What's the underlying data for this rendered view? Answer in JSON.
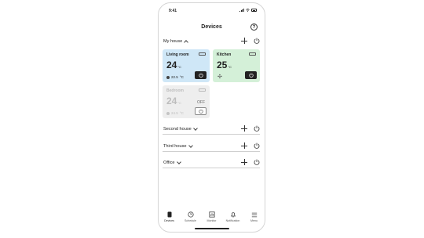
{
  "status_bar": {
    "time": "9:41"
  },
  "header": {
    "title": "Devices"
  },
  "houses": [
    {
      "name": "My house",
      "expanded": true
    },
    {
      "name": "Second house",
      "expanded": false
    },
    {
      "name": "Third house",
      "expanded": false
    },
    {
      "name": "Office",
      "expanded": false
    }
  ],
  "devices": [
    {
      "room": "Living room",
      "temperature": "24",
      "unit": "°C",
      "setpoint": "22.5",
      "setpoint_unit": "°C",
      "power": "on",
      "color": "#cfe7f7"
    },
    {
      "room": "Kitchen",
      "temperature": "25",
      "unit": "°C",
      "mode_icon": "fan-icon",
      "power": "on",
      "color": "#d4f0d8"
    },
    {
      "room": "Bedroom",
      "temperature": "24",
      "unit": "°C",
      "setpoint": "24.5",
      "setpoint_unit": "°C",
      "power": "off",
      "off_label": "OFF",
      "color": "#eeeeee"
    }
  ],
  "tabs": [
    {
      "label": "Devices",
      "icon": "phone-icon",
      "active": true
    },
    {
      "label": "Schedule",
      "icon": "clock-icon",
      "active": false
    },
    {
      "label": "Monitor",
      "icon": "chart-icon",
      "active": false
    },
    {
      "label": "Notification",
      "icon": "bell-icon",
      "active": false
    },
    {
      "label": "Menu",
      "icon": "menu-icon",
      "active": false
    }
  ]
}
